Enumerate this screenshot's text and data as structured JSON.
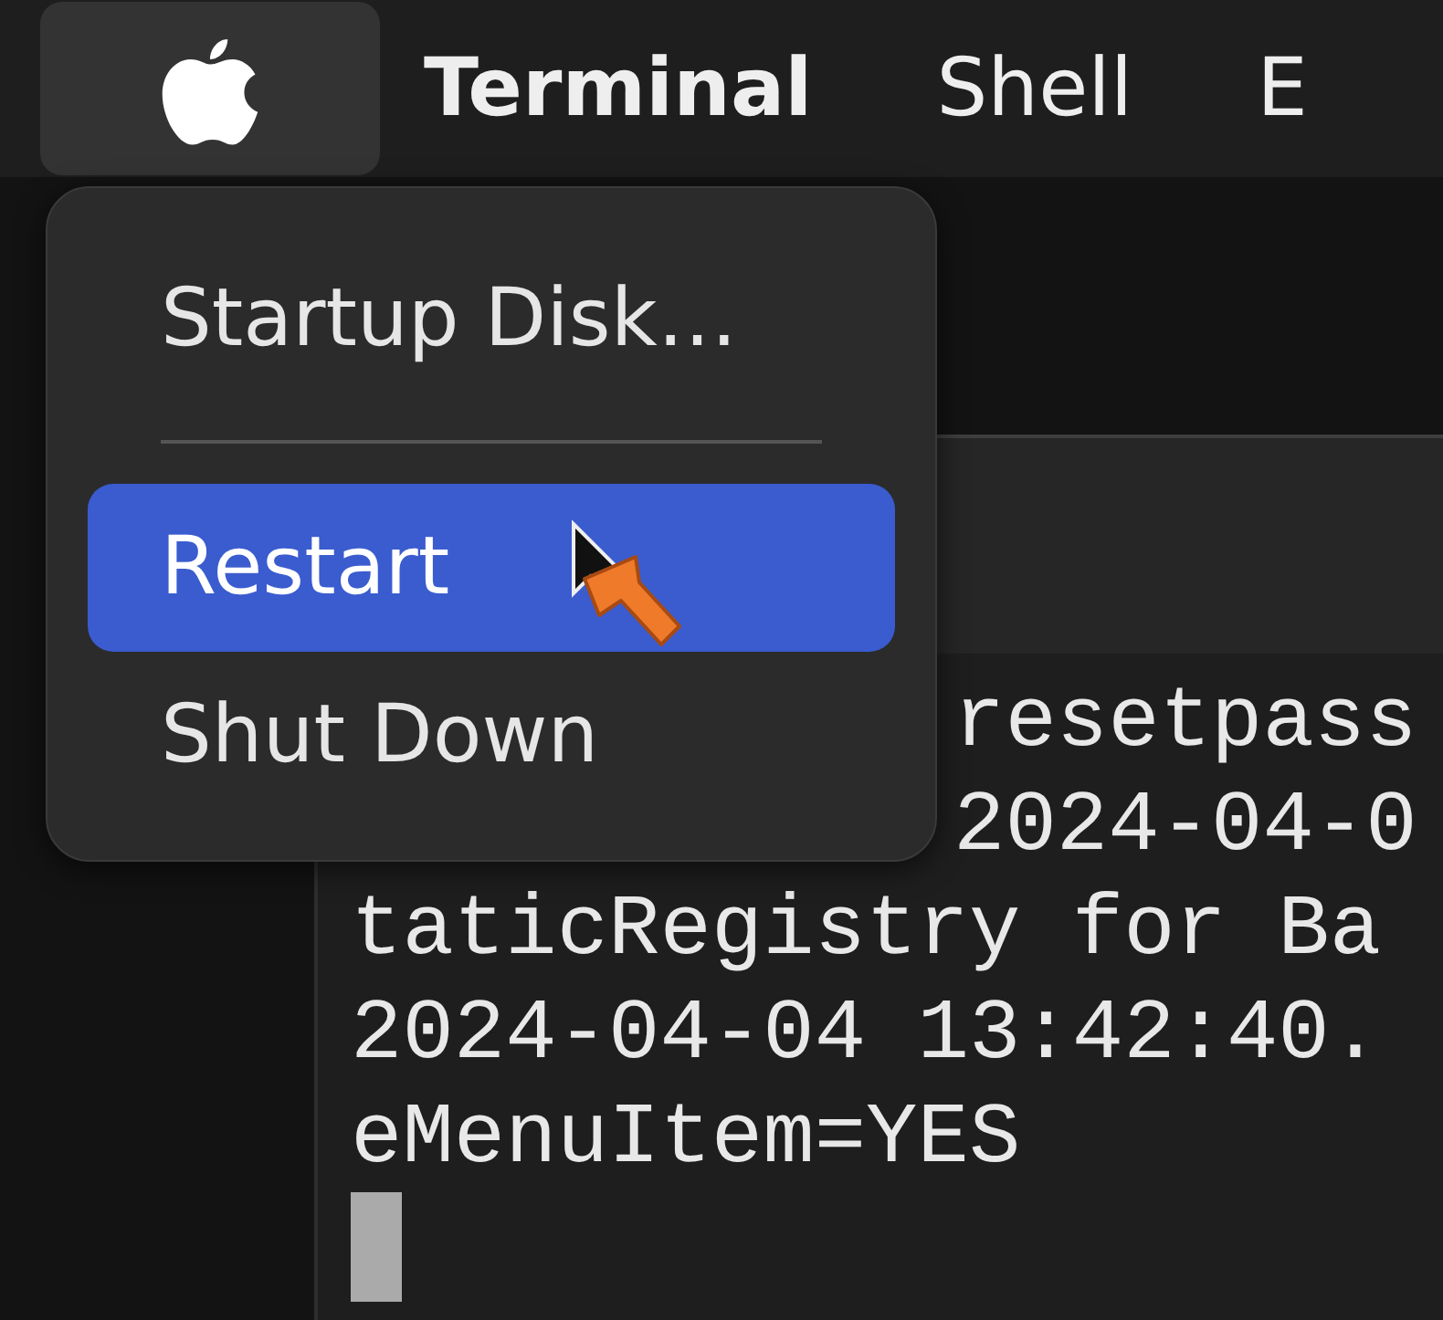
{
  "menu_bar": [
    {
      "kind": "apple",
      "selected": true
    },
    {
      "kind": "app",
      "label": "Terminal",
      "selected": false
    },
    {
      "kind": "text",
      "label": "Shell",
      "selected": false
    },
    {
      "kind": "text",
      "label": "E",
      "selected": false
    }
  ],
  "apple_menu": {
    "items": [
      {
        "kind": "item",
        "label": "Startup Disk…",
        "selected": false
      },
      {
        "kind": "separator"
      },
      {
        "kind": "item",
        "label": "Restart",
        "selected": true
      },
      {
        "kind": "item",
        "label": "Shut Down",
        "selected": false
      }
    ]
  },
  "terminal": {
    "lines": [
      {
        "kind": "covered",
        "text": "resetpass"
      },
      {
        "kind": "covered",
        "text": "2024-04-0"
      },
      {
        "kind": "full",
        "text": "taticRegistry for Ba"
      },
      {
        "kind": "full",
        "text": "2024-04-04 13:42:40."
      },
      {
        "kind": "full",
        "text": "eMenuItem=YES"
      }
    ],
    "cursor": true
  }
}
